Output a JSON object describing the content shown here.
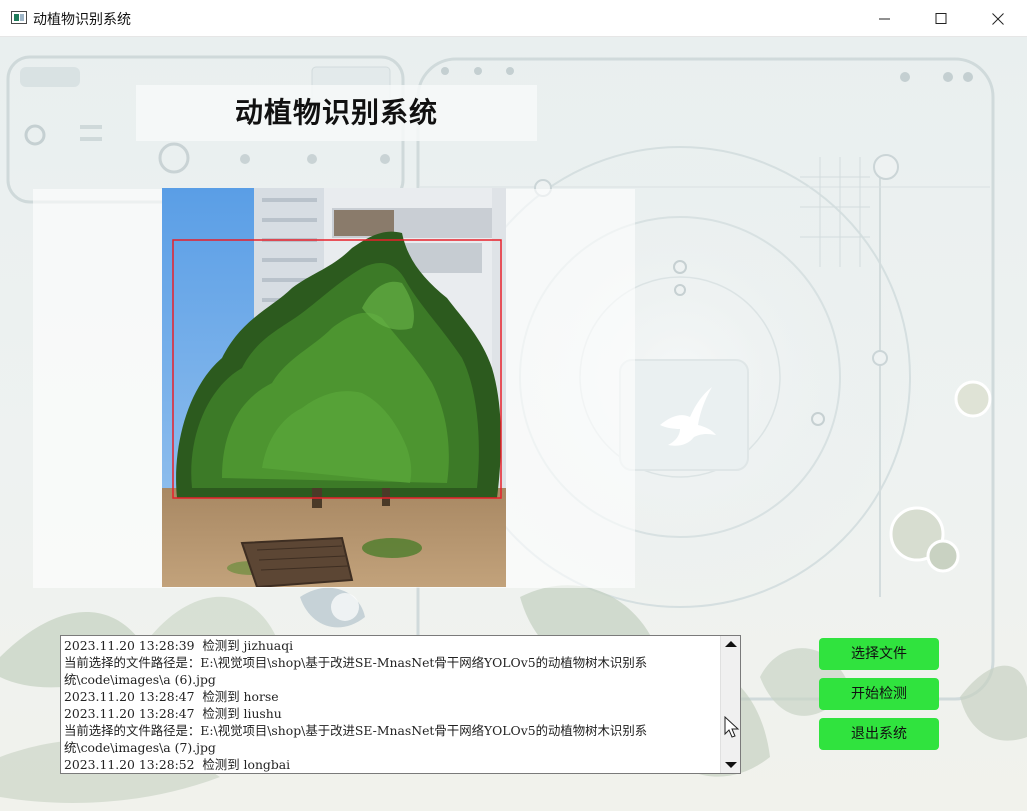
{
  "window": {
    "title": "动植物识别系统"
  },
  "header": {
    "title": "动植物识别系统"
  },
  "log": {
    "lines": [
      "2023.11.20 13:28:39  检测到 jizhuaqi",
      "当前选择的文件路径是：E:\\视觉项目\\shop\\基于改进SE-MnasNet骨干网络YOLOv5的动植物树木识别系",
      "统\\code\\images\\a (6).jpg",
      "2023.11.20 13:28:47  检测到 horse",
      "2023.11.20 13:28:47  检测到 liushu",
      "当前选择的文件路径是：E:\\视觉项目\\shop\\基于改进SE-MnasNet骨干网络YOLOv5的动植物树木识别系",
      "统\\code\\images\\a (7).jpg",
      "2023.11.20 13:28:52  检测到 longbai"
    ]
  },
  "actions": {
    "select_file": "选择文件",
    "start_detect": "开始检测",
    "exit_system": "退出系统"
  },
  "colors": {
    "button_green": "#30e33e",
    "detection_box": "#e8202a"
  },
  "icons": {
    "app": "app-window-icon",
    "minimize": "minimize-icon",
    "maximize": "maximize-icon",
    "close": "close-icon"
  }
}
